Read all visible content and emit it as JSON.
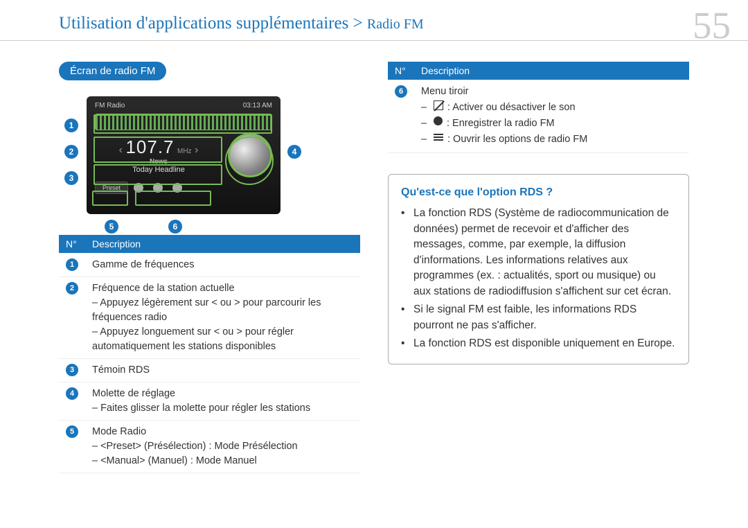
{
  "header": {
    "title": "Utilisation d'applications supplémentaires",
    "separator": " > ",
    "subtitle": "Radio FM",
    "page_number": "55"
  },
  "section_pill": "Écran de radio FM",
  "screenshot": {
    "title": "FM Radio",
    "time": "03:13 AM",
    "freq_value": "107.7",
    "freq_unit": "MHz",
    "news": "News",
    "headline": "Today Headline",
    "preset_btn": "Preset"
  },
  "callouts": [
    "1",
    "2",
    "3",
    "4",
    "5",
    "6"
  ],
  "table_left": {
    "head_num": "N°",
    "head_desc": "Description",
    "rows": [
      {
        "n": "1",
        "lines": [
          "Gamme de fréquences"
        ]
      },
      {
        "n": "2",
        "lines": [
          "Fréquence de la station actuelle",
          "– Appuyez légèrement sur  < ou > pour parcourir les fréquences radio",
          "– Appuyez longuement sur  < ou > pour régler automatiquement les stations disponibles"
        ]
      },
      {
        "n": "3",
        "lines": [
          "Témoin RDS"
        ]
      },
      {
        "n": "4",
        "lines": [
          "Molette de réglage",
          "– Faites glisser la molette pour régler les stations"
        ]
      },
      {
        "n": "5",
        "lines": [
          "Mode Radio",
          "– <Preset> (Présélection) : Mode Présélection",
          "– <Manual> (Manuel) : Mode Manuel"
        ]
      }
    ]
  },
  "table_right": {
    "head_num": "N°",
    "head_desc": "Description",
    "rows": [
      {
        "n": "6",
        "title": "Menu tiroir",
        "icons": [
          {
            "icon": "mute-icon",
            "text": ": Activer ou désactiver le son"
          },
          {
            "icon": "record-icon",
            "text": ": Enregistrer la radio FM"
          },
          {
            "icon": "menu-icon",
            "text": ": Ouvrir les options de radio FM"
          }
        ]
      }
    ]
  },
  "infobox": {
    "question": "Qu'est-ce que l'option RDS ?",
    "items": [
      "La fonction RDS (Système de radiocommunication de données) permet de recevoir et d'afficher des messages, comme, par exemple, la diffusion d'informations. Les informations relatives aux programmes (ex. : actualités, sport ou musique) ou aux stations de radiodiffusion s'affichent sur cet écran.",
      "Si le signal FM est faible, les informations RDS pourront ne pas s'afficher.",
      "La fonction RDS est disponible uniquement en Europe."
    ]
  }
}
